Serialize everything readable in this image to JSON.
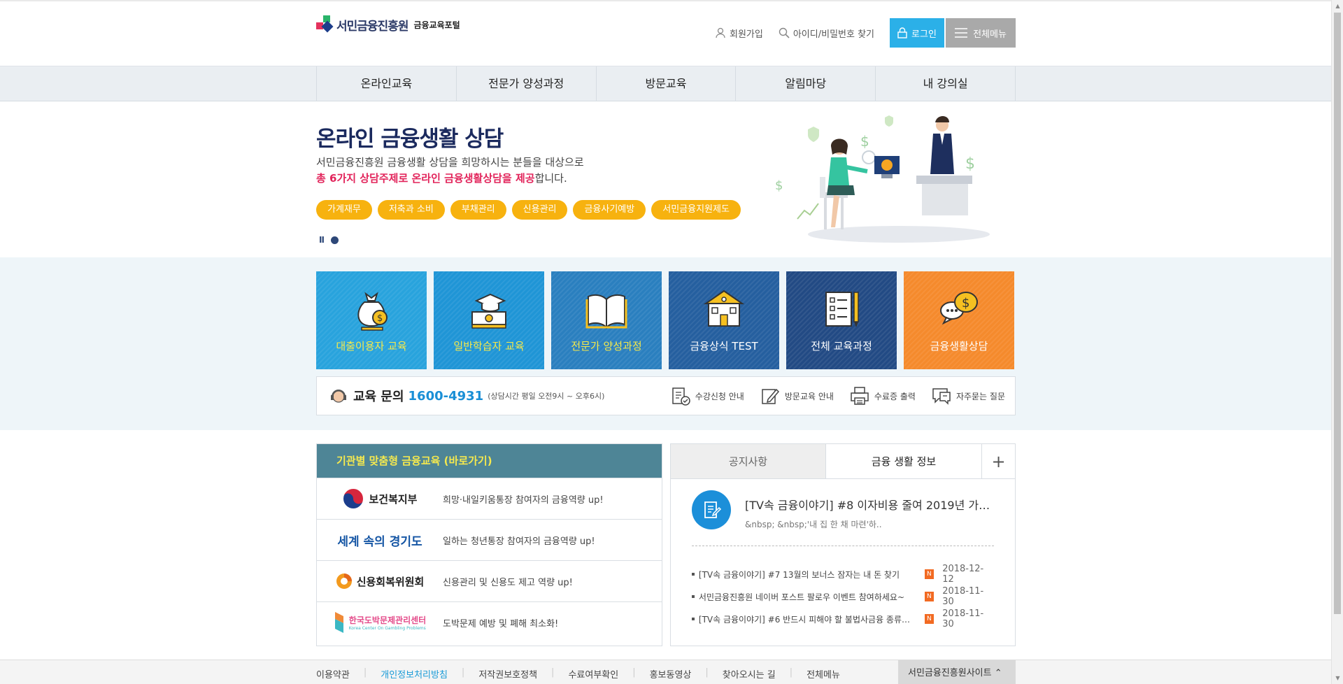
{
  "header": {
    "logo_name": "서민금융진흥원",
    "logo_sub": "금융교육포털",
    "join": "회원가입",
    "find": "아이디/비밀번호 찾기",
    "login": "로그인",
    "allmenu": "전체메뉴"
  },
  "gnb": [
    "온라인교육",
    "전문가 양성과정",
    "방문교육",
    "알림마당",
    "내 강의실"
  ],
  "hero": {
    "title": "온라인 금융생활 상담",
    "desc1": "서민금융진흥원 금융생활 상담을 희망하시는 분들을 대상으로",
    "desc2_bold": "총 6가지 상담주제로 온라인 금융생활상담을 제공",
    "desc2_rest": "합니다.",
    "tags": [
      "가계재무",
      "저축과 소비",
      "부채관리",
      "신용관리",
      "금융사기예방",
      "서민금융지원제도"
    ],
    "pause": "II"
  },
  "tiles": [
    {
      "label": "대출이용자 교육",
      "icon": "money-bag-icon",
      "color": "#28a3dd",
      "label_color": "#f6e94a"
    },
    {
      "label": "일반학습자 교육",
      "icon": "graduation-money-icon",
      "color": "#1f95d6",
      "label_color": "#f6e94a"
    },
    {
      "label": "전문가 양성과정",
      "icon": "open-book-icon",
      "color": "#2a7fbf",
      "label_color": "#f6e94a"
    },
    {
      "label": "금융상식 TEST",
      "icon": "school-building-icon",
      "color": "#255f9f",
      "label_color": "#ffffff"
    },
    {
      "label": "전체 교육과정",
      "icon": "checklist-icon",
      "color": "#224a84",
      "label_color": "#ffffff"
    },
    {
      "label": "금융생활상담",
      "icon": "chat-money-icon",
      "color": "#f58a2c",
      "label_color": "#ffffff"
    }
  ],
  "info": {
    "label": "교육 문의",
    "phone": "1600-4931",
    "hours": "(상담시간 평일 오전9시 ~ 오후6시)",
    "links": [
      "수강신청 안내",
      "방문교육 안내",
      "수료증 출력",
      "자주묻는 질문"
    ]
  },
  "institutions": {
    "title": "기관별 맞춤형 금융교육 (바로가기)",
    "rows": [
      {
        "name": "보건복지부",
        "text": "희망·내일키움통장 참여자의 금융역량 up!"
      },
      {
        "name": "세계 속의 경기도",
        "text": "일하는 청년통장 참여자의 금융역량 up!"
      },
      {
        "name": "신용회복위원회",
        "text": "신용관리 및 신용도 제고 역량 up!"
      },
      {
        "name": "한국도박문제관리센터",
        "sub": "Korea Center On Gambling Problems",
        "text": "도박문제 예방 및 폐해 최소화!"
      }
    ]
  },
  "tabs": {
    "tab1": "공지사항",
    "tab2": "금융 생활 정보",
    "plus": "+",
    "featured_title": "[TV속 금융이야기] #8 이자비용 줄여 2019년 가…",
    "featured_excerpt": "&nbsp; &nbsp;'내 집 한 채 마련'하..",
    "new_badge": "N",
    "items": [
      {
        "title": "[TV속 금융이야기] #7 13월의 보너스 잠자는 내 돈 찾기",
        "date": "2018-12-12"
      },
      {
        "title": "서민금융진흥원 네이버 포스트 팔로우 이벤트 참여하세요~",
        "date": "2018-11-30"
      },
      {
        "title": "[TV속 금융이야기] #6 반드시 피해야 할 불법사금융 종류…",
        "date": "2018-11-30"
      }
    ]
  },
  "footer": {
    "links": [
      "이용약관",
      "개인정보처리방침",
      "저작권보호정책",
      "수료여부확인",
      "홍보동영상",
      "찾아오시는 길",
      "전체메뉴"
    ],
    "site": "서민금융진흥원사이트 ⌃"
  }
}
